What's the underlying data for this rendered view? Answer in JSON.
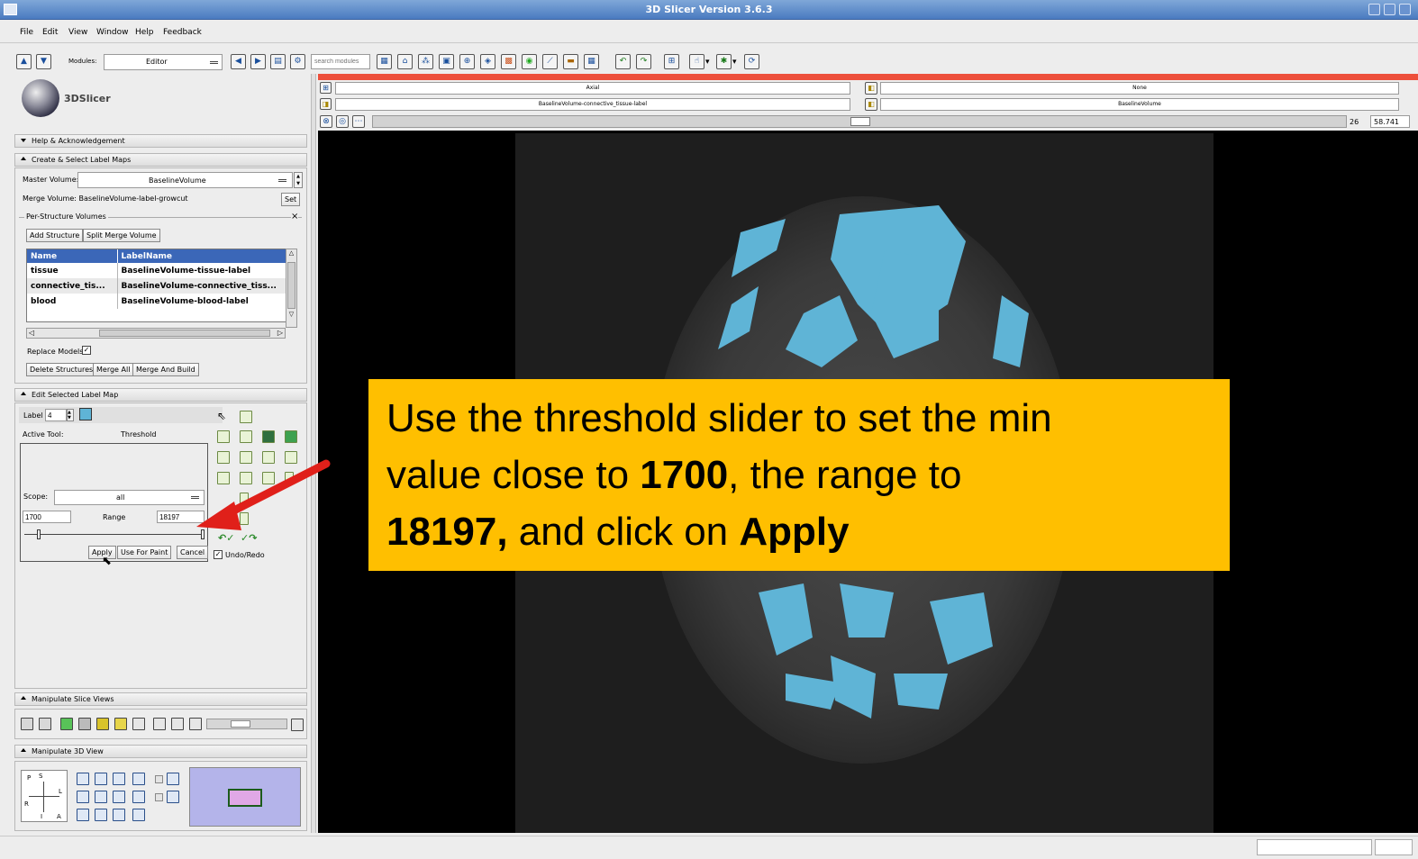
{
  "window": {
    "title": "3D Slicer Version 3.6.3"
  },
  "menu": [
    "File",
    "Edit",
    "View",
    "Window",
    "Help",
    "Feedback"
  ],
  "toolbar": {
    "modules_label": "Modules:",
    "module_value": "Editor",
    "search_placeholder": "search modules"
  },
  "logo": {
    "text": "3DSlicer"
  },
  "sections": {
    "help": "Help & Acknowledgement",
    "create": "Create & Select Label Maps",
    "edit": "Edit Selected Label Map",
    "manip_slice": "Manipulate Slice Views",
    "manip_3d": "Manipulate 3D View"
  },
  "create_panel": {
    "master_label": "Master Volume:",
    "master_value": "BaselineVolume",
    "merge_label": "Merge Volume:",
    "merge_value": "BaselineVolume-label-growcut",
    "set_button": "Set",
    "per_structure": "Per-Structure Volumes",
    "close_x": "×",
    "add_structure": "Add Structure",
    "split_merge": "Split Merge Volume",
    "columns": [
      "Name",
      "LabelName"
    ],
    "rows": [
      [
        "tissue",
        "BaselineVolume-tissue-label"
      ],
      [
        "connective_tis...",
        "BaselineVolume-connective_tiss..."
      ],
      [
        "blood",
        "BaselineVolume-blood-label"
      ]
    ],
    "replace_models": "Replace Models",
    "delete_structures": "Delete Structures",
    "merge_all": "Merge All",
    "merge_and_build": "Merge And Build"
  },
  "edit_panel": {
    "label_text": "Label",
    "label_value": "4",
    "label_color": "#5fb4d6",
    "active_tool_label": "Active Tool:",
    "active_tool_value": "Threshold",
    "scope_label": "Scope:",
    "scope_value": "all",
    "min_value": "1700",
    "range_label": "Range",
    "max_value": "18197",
    "apply": "Apply",
    "use_for_paint": "Use For Paint",
    "cancel": "Cancel",
    "undo_redo": "Undo/Redo"
  },
  "manip_3d": {
    "orient_letters": [
      "P",
      "S",
      "L",
      "R",
      "I",
      "A"
    ]
  },
  "slice_view": {
    "orientation": "Axial",
    "fg_none": "None",
    "label_volume": "BaselineVolume-connective_tissue-label",
    "bg_volume": "BaselineVolume",
    "slice_index": "26",
    "slice_offset": "58.741",
    "overlay_color": "#5fb4d6"
  },
  "callout": {
    "line1": "Use the threshold slider to set the min",
    "line2_pre": "value close to ",
    "line2_bold": "1700",
    "line2_post": ", the range to",
    "line3_bold1": "18197,",
    "line3_mid": " and click on ",
    "line3_bold2": "Apply",
    "bg": "#ffbf00"
  }
}
